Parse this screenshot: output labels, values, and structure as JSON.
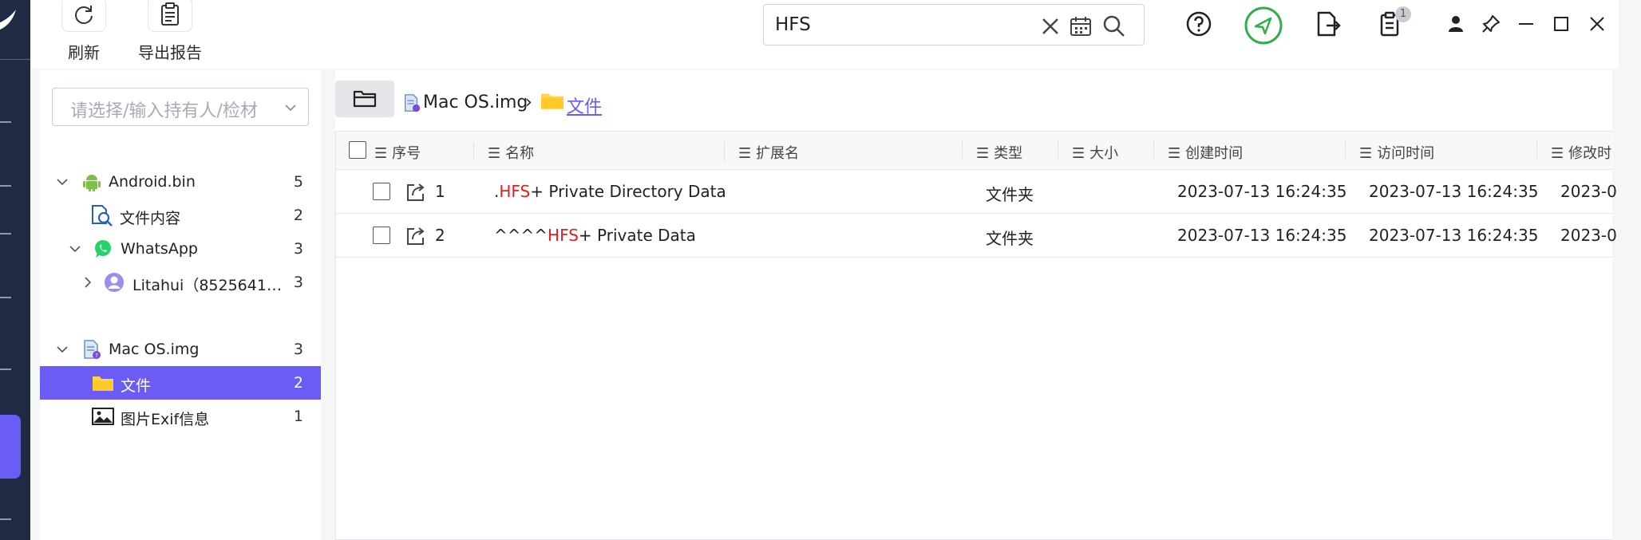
{
  "toolbar": {
    "refresh_label": "刷新",
    "export_label": "导出报告"
  },
  "search": {
    "value": "HFS",
    "clear_icon": "close-icon",
    "calendar_icon": "calendar-icon",
    "search_icon": "search-icon"
  },
  "top_actions": {
    "help_icon": "help-icon",
    "send_icon": "send-icon",
    "export_file_icon": "export-file-icon",
    "task_list_icon": "task-list-icon",
    "task_badge": "1",
    "user_icon": "user-icon",
    "pin_icon": "pin-icon",
    "minimize_icon": "minimize-icon",
    "maximize_icon": "maximize-icon",
    "close_icon": "close-icon"
  },
  "left": {
    "holder_placeholder": "请选择/输入持有人/检材",
    "tree": [
      {
        "label": "Android.bin",
        "count": "5"
      },
      {
        "label": "文件内容",
        "count": "2"
      },
      {
        "label": "WhatsApp",
        "count": "3"
      },
      {
        "label": "Litahui（8525641…",
        "count": "3"
      },
      {
        "label": "Mac OS.img",
        "count": "3"
      },
      {
        "label": "文件",
        "count": "2"
      },
      {
        "label": "图片Exif信息",
        "count": "1"
      }
    ]
  },
  "breadcrumb": {
    "items": [
      "Mac OS.img",
      "文件"
    ],
    "separator": "›"
  },
  "table": {
    "headers": {
      "seq": "序号",
      "name": "名称",
      "ext": "扩展名",
      "type": "类型",
      "size": "大小",
      "created": "创建时间",
      "accessed": "访问时间",
      "modified": "修改时"
    },
    "rows": [
      {
        "seq": "1",
        "name_pre": ".",
        "name_hl": "HFS",
        "name_post": "+ Private Directory Data",
        "ext": "",
        "type": "文件夹",
        "size": "",
        "created": "2023-07-13 16:24:35",
        "accessed": "2023-07-13 16:24:35",
        "modified": "2023-0"
      },
      {
        "seq": "2",
        "name_pre": "^^^^",
        "name_hl": "HFS",
        "name_post": "+ Private Data",
        "ext": "",
        "type": "文件夹",
        "size": "",
        "created": "2023-07-13 16:24:35",
        "accessed": "2023-07-13 16:24:35",
        "modified": "2023-0"
      }
    ]
  },
  "colors": {
    "accent": "#6b5cf5",
    "highlight": "#e02020",
    "send_green": "#2fae4a"
  }
}
